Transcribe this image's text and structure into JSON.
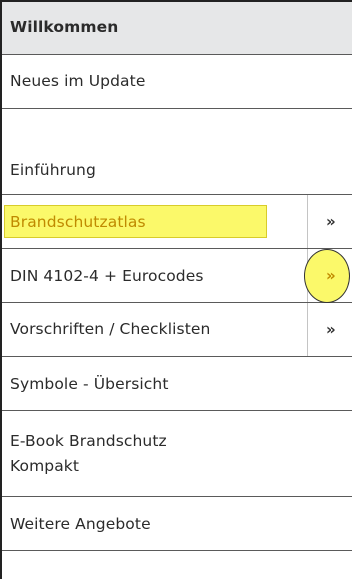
{
  "menu": {
    "header_label": "Willkommen",
    "items": [
      {
        "label": "Neues im Update"
      },
      {
        "label": "Einführung"
      },
      {
        "label": "Brandschutzatlas",
        "chevron": "»"
      },
      {
        "label": "DIN 4102-4 + Eurocodes",
        "chevron": "»"
      },
      {
        "label": "Vorschriften / Checklisten",
        "chevron": "»"
      },
      {
        "label": "Symbole - Übersicht"
      },
      {
        "label_line1": "E-Book Brandschutz",
        "label_line2": "Kompakt"
      },
      {
        "label": "Weitere Angebote"
      }
    ]
  },
  "colors": {
    "highlight": "#fbf96a",
    "highlight_text": "#b8860b",
    "header_bg": "#e6e7e8"
  }
}
